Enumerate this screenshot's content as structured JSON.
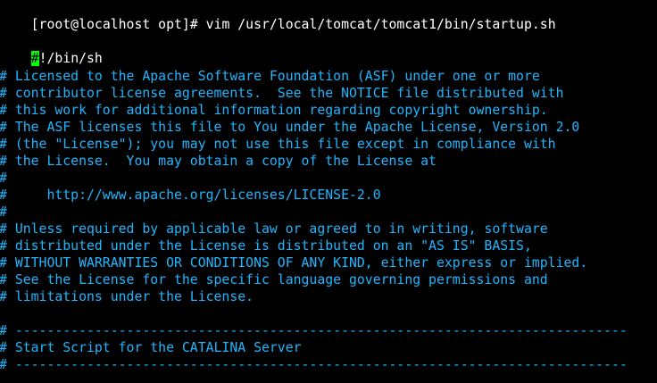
{
  "terminal": {
    "prompt": "[root@localhost opt]#",
    "command": " vim /usr/local/tomcat/tomcat1/bin/startup.sh",
    "cursor_char": "#",
    "shebang_rest": "!/bin/sh",
    "comment_lines": [
      "# Licensed to the Apache Software Foundation (ASF) under one or more",
      "# contributor license agreements.  See the NOTICE file distributed with",
      "# this work for additional information regarding copyright ownership.",
      "# The ASF licenses this file to You under the Apache License, Version 2.0",
      "# (the \"License\"); you may not use this file except in compliance with",
      "# the License.  You may obtain a copy of the License at",
      "#",
      "#     http://www.apache.org/licenses/LICENSE-2.0",
      "#",
      "# Unless required by applicable law or agreed to in writing, software",
      "# distributed under the License is distributed on an \"AS IS\" BASIS,",
      "# WITHOUT WARRANTIES OR CONDITIONS OF ANY KIND, either express or implied.",
      "# See the License for the specific language governing permissions and",
      "# limitations under the License."
    ],
    "separator_top": "# -----------------------------------------------------------------------------",
    "section_title": "# Start Script for the CATALINA Server",
    "separator_bottom": "# -----------------------------------------------------------------------------"
  },
  "colors": {
    "background": "#000000",
    "text": "#ffffff",
    "comment": "#1fb6ff",
    "cursor": "#00ff00"
  }
}
